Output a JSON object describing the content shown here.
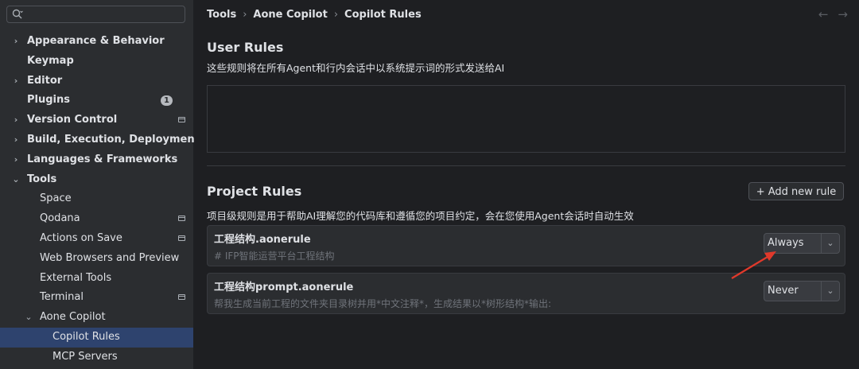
{
  "search": {
    "placeholder": ""
  },
  "sidebar": {
    "items": [
      {
        "label": "Appearance & Behavior",
        "chevron": "›",
        "bold": true
      },
      {
        "label": "Keymap",
        "bold": true
      },
      {
        "label": "Editor",
        "chevron": "›",
        "bold": true
      },
      {
        "label": "Plugins",
        "bold": true,
        "badge": "1"
      },
      {
        "label": "Version Control",
        "chevron": "›",
        "bold": true,
        "project_icon": true
      },
      {
        "label": "Build, Execution, Deployment",
        "chevron": "›",
        "bold": true
      },
      {
        "label": "Languages & Frameworks",
        "chevron": "›",
        "bold": true
      },
      {
        "label": "Tools",
        "chevron": "⌄",
        "bold": true
      },
      {
        "label": "Space"
      },
      {
        "label": "Qodana",
        "project_icon": true
      },
      {
        "label": "Actions on Save",
        "project_icon": true
      },
      {
        "label": "Web Browsers and Preview"
      },
      {
        "label": "External Tools"
      },
      {
        "label": "Terminal",
        "project_icon": true
      },
      {
        "label": "Aone Copilot",
        "chevron": "⌄"
      },
      {
        "label": "Copilot Rules",
        "selected": true
      },
      {
        "label": "MCP Servers"
      }
    ]
  },
  "breadcrumb": [
    "Tools",
    "Aone Copilot",
    "Copilot Rules"
  ],
  "nav": {
    "back": "←",
    "forward": "→"
  },
  "user_rules": {
    "title": "User Rules",
    "description": "这些规则将在所有Agent和行内会话中以系统提示词的形式发送给AI"
  },
  "project_rules": {
    "title": "Project Rules",
    "add_button": "+ Add new rule",
    "description": "项目级规则是用于帮助AI理解您的代码库和遵循您的项目约定，会在您使用Agent会话时自动生效",
    "rules": [
      {
        "name": "工程结构.aonerule",
        "desc": "# IFP智能运营平台工程结构",
        "mode": "Always"
      },
      {
        "name": "工程结构prompt.aonerule",
        "desc": "帮我生成当前工程的文件夹目录树并用*中文注释*，生成结果以*树形结构*输出:",
        "mode": "Never"
      }
    ]
  },
  "colors": {
    "accent_selected": "#2e436e",
    "annotation_arrow": "#e0392b"
  }
}
